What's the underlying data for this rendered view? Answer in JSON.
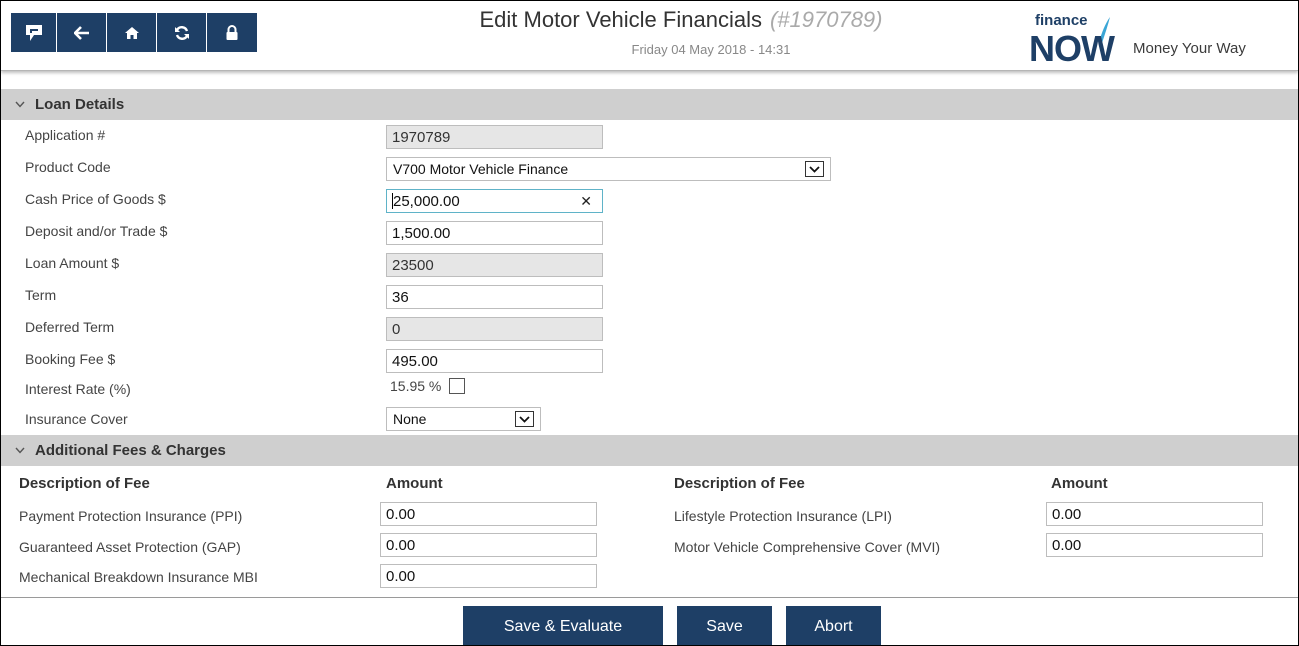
{
  "header": {
    "title": "Edit Motor Vehicle Financials",
    "application_ref": "(#1970789)",
    "datetime": "Friday 04 May 2018 - 14:31",
    "brand_small": "finance",
    "brand_large": "NOW",
    "slogan": "Money Your Way"
  },
  "toolbar": {
    "buttons": [
      {
        "name": "app-logo",
        "icon": "logo-icon"
      },
      {
        "name": "back",
        "icon": "arrow-left-icon"
      },
      {
        "name": "home",
        "icon": "home-icon"
      },
      {
        "name": "refresh",
        "icon": "refresh-icon"
      },
      {
        "name": "lock",
        "icon": "lock-icon"
      }
    ]
  },
  "loan_details": {
    "section_title": "Loan Details",
    "fields": {
      "application_no": {
        "label": "Application #",
        "value": "1970789"
      },
      "product_code": {
        "label": "Product Code",
        "value": "V700 Motor Vehicle Finance"
      },
      "cash_price": {
        "label": "Cash Price of Goods $",
        "value": "25,000.00"
      },
      "deposit": {
        "label": "Deposit and/or Trade $",
        "value": "1,500.00"
      },
      "loan_amount": {
        "label": "Loan Amount $",
        "value": "23500"
      },
      "term": {
        "label": "Term",
        "value": "36"
      },
      "deferred_term": {
        "label": "Deferred Term",
        "value": "0"
      },
      "booking_fee": {
        "label": "Booking Fee $",
        "value": "495.00"
      },
      "interest_rate": {
        "label": "Interest Rate (%)",
        "value": "15.95 %"
      },
      "insurance_cover": {
        "label": "Insurance Cover",
        "value": "None"
      }
    }
  },
  "fees": {
    "section_title": "Additional Fees & Charges",
    "col_description": "Description of Fee",
    "col_amount": "Amount",
    "left": [
      {
        "label": "Payment Protection Insurance (PPI)",
        "value": "0.00"
      },
      {
        "label": "Guaranteed Asset Protection (GAP)",
        "value": "0.00"
      },
      {
        "label": "Mechanical Breakdown Insurance MBI",
        "value": "0.00"
      }
    ],
    "right": [
      {
        "label": "Lifestyle Protection Insurance (LPI)",
        "value": "0.00"
      },
      {
        "label": "Motor Vehicle Comprehensive Cover (MVI)",
        "value": "0.00"
      }
    ]
  },
  "actions": {
    "save_evaluate": "Save & Evaluate",
    "save": "Save",
    "abort": "Abort"
  },
  "colors": {
    "primary": "#1e3f66",
    "section_bar": "#cfcfcf",
    "readonly_field": "#e6e6e6",
    "focus_border": "#5fb3c8"
  }
}
